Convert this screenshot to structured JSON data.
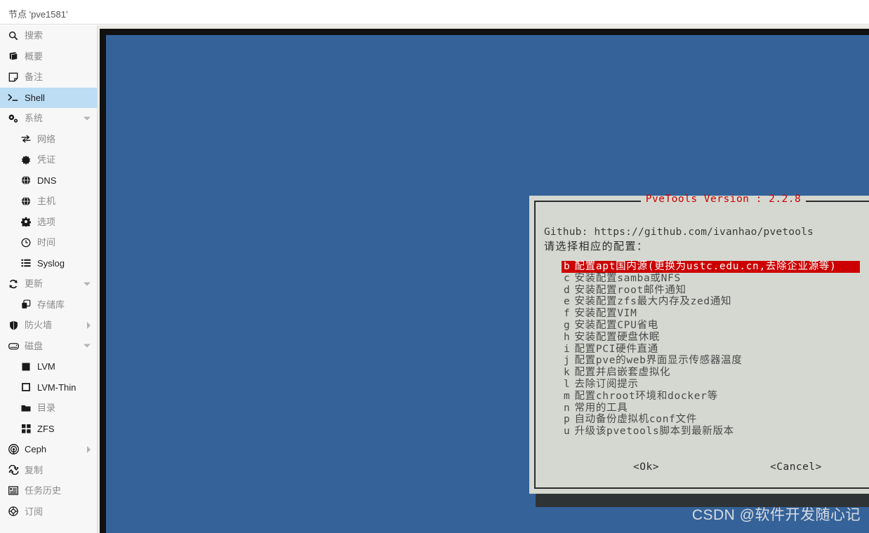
{
  "header": {
    "title": "节点 'pve1581'"
  },
  "sidebar": {
    "items": [
      {
        "label": "搜索",
        "icon": "search-icon",
        "level": 0,
        "selected": false,
        "arrow": "none",
        "dark": false
      },
      {
        "label": "概要",
        "icon": "book-icon",
        "level": 0,
        "selected": false,
        "arrow": "none",
        "dark": false
      },
      {
        "label": "备注",
        "icon": "note-icon",
        "level": 0,
        "selected": false,
        "arrow": "none",
        "dark": false
      },
      {
        "label": "Shell",
        "icon": "terminal-icon",
        "level": 0,
        "selected": true,
        "arrow": "none",
        "dark": true
      },
      {
        "label": "系统",
        "icon": "gears-icon",
        "level": 0,
        "selected": false,
        "arrow": "down",
        "dark": false
      },
      {
        "label": "网络",
        "icon": "network-icon",
        "level": 1,
        "selected": false,
        "arrow": "none",
        "dark": false
      },
      {
        "label": "凭证",
        "icon": "certificate-icon",
        "level": 1,
        "selected": false,
        "arrow": "none",
        "dark": false
      },
      {
        "label": "DNS",
        "icon": "globe-icon",
        "level": 1,
        "selected": false,
        "arrow": "none",
        "dark": true
      },
      {
        "label": "主机",
        "icon": "globe-icon",
        "level": 1,
        "selected": false,
        "arrow": "none",
        "dark": false
      },
      {
        "label": "选项",
        "icon": "gear-icon",
        "level": 1,
        "selected": false,
        "arrow": "none",
        "dark": false
      },
      {
        "label": "时间",
        "icon": "clock-icon",
        "level": 1,
        "selected": false,
        "arrow": "none",
        "dark": false
      },
      {
        "label": "Syslog",
        "icon": "list-icon",
        "level": 1,
        "selected": false,
        "arrow": "none",
        "dark": true
      },
      {
        "label": "更新",
        "icon": "refresh-icon",
        "level": 0,
        "selected": false,
        "arrow": "down",
        "dark": false
      },
      {
        "label": "存储库",
        "icon": "copy-icon",
        "level": 1,
        "selected": false,
        "arrow": "none",
        "dark": false
      },
      {
        "label": "防火墙",
        "icon": "shield-icon",
        "level": 0,
        "selected": false,
        "arrow": "right",
        "dark": false
      },
      {
        "label": "磁盘",
        "icon": "disk-icon",
        "level": 0,
        "selected": false,
        "arrow": "down",
        "dark": false
      },
      {
        "label": "LVM",
        "icon": "square-filled-icon",
        "level": 1,
        "selected": false,
        "arrow": "none",
        "dark": true
      },
      {
        "label": "LVM-Thin",
        "icon": "square-outline-icon",
        "level": 1,
        "selected": false,
        "arrow": "none",
        "dark": true
      },
      {
        "label": "目录",
        "icon": "folder-icon",
        "level": 1,
        "selected": false,
        "arrow": "none",
        "dark": false
      },
      {
        "label": "ZFS",
        "icon": "grid-icon",
        "level": 1,
        "selected": false,
        "arrow": "none",
        "dark": true
      },
      {
        "label": "Ceph",
        "icon": "ceph-icon",
        "level": 0,
        "selected": false,
        "arrow": "right",
        "dark": true
      },
      {
        "label": "复制",
        "icon": "replicate-icon",
        "level": 0,
        "selected": false,
        "arrow": "none",
        "dark": false
      },
      {
        "label": "任务历史",
        "icon": "tasklog-icon",
        "level": 0,
        "selected": false,
        "arrow": "none",
        "dark": false
      },
      {
        "label": "订阅",
        "icon": "lifebuoy-icon",
        "level": 0,
        "selected": false,
        "arrow": "none",
        "dark": false
      }
    ]
  },
  "dialog": {
    "title": "PveTools   Version : 2.2.8",
    "github": "Github: https://github.com/ivanhao/pvetools",
    "prompt": "请选择相应的配置：",
    "menu_items": [
      {
        "key": "b",
        "text": "配置apt国内源(更换为ustc.edu.cn,去除企业源等)",
        "selected": true
      },
      {
        "key": "c",
        "text": "安装配置samba或NFS",
        "selected": false
      },
      {
        "key": "d",
        "text": "安装配置root邮件通知",
        "selected": false
      },
      {
        "key": "e",
        "text": "安装配置zfs最大内存及zed通知",
        "selected": false
      },
      {
        "key": "f",
        "text": "安装配置VIM",
        "selected": false
      },
      {
        "key": "g",
        "text": "安装配置CPU省电",
        "selected": false
      },
      {
        "key": "h",
        "text": "安装配置硬盘休眠",
        "selected": false
      },
      {
        "key": "i",
        "text": "配置PCI硬件直通",
        "selected": false
      },
      {
        "key": "j",
        "text": "配置pve的web界面显示传感器温度",
        "selected": false
      },
      {
        "key": "k",
        "text": "配置并启嵌套虚拟化",
        "selected": false
      },
      {
        "key": "l",
        "text": "去除订阅提示",
        "selected": false
      },
      {
        "key": "m",
        "text": "配置chroot环境和docker等",
        "selected": false
      },
      {
        "key": "n",
        "text": "常用的工具",
        "selected": false
      },
      {
        "key": "p",
        "text": "自动备份虚拟机conf文件",
        "selected": false
      },
      {
        "key": "u",
        "text": "升级该pvetools脚本到最新版本",
        "selected": false
      }
    ],
    "scrollbar": {
      "up_glyph": "↑",
      "down_glyph": "↓"
    },
    "ok_label": "<Ok>",
    "cancel_label": "<Cancel>"
  },
  "watermark": {
    "text": "CSDN @软件开发随心记"
  },
  "colors": {
    "terminal_background": "#356399",
    "dialog_background": "#d5d8d0",
    "accent_red": "#cc0000",
    "selected_nav": "#bcddf4",
    "shadow": "#2e3335"
  }
}
